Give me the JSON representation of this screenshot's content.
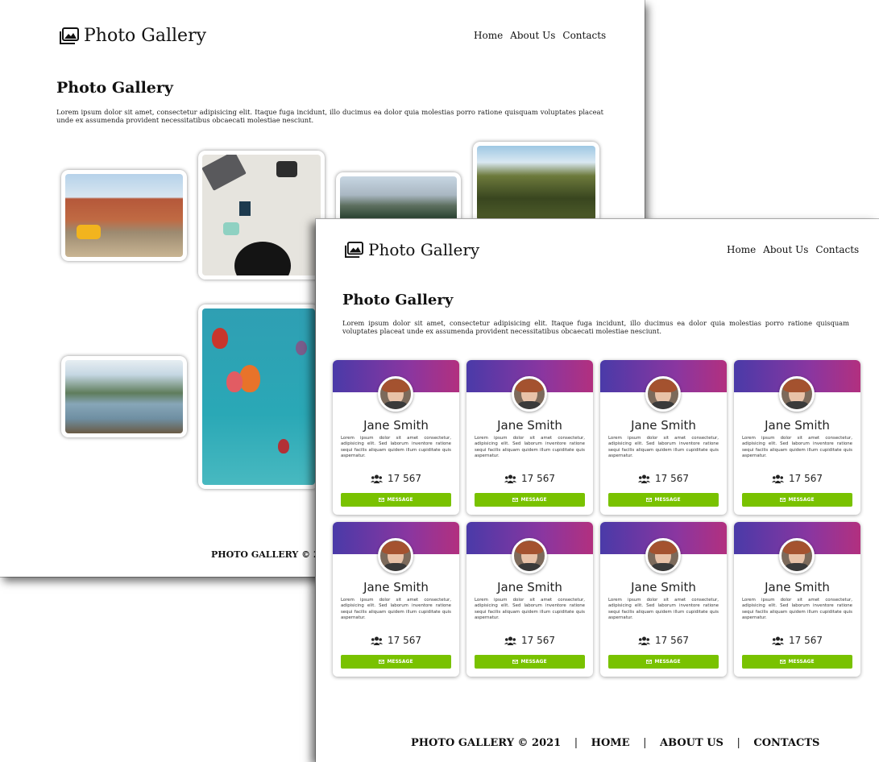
{
  "colors": {
    "card_gradient_start": "#4a3aa8",
    "card_gradient_end": "#b2307f",
    "message_button": "#79c200",
    "text": "#111111"
  },
  "back_page": {
    "logo_text": "Photo Gallery",
    "logo_icon": "image-gallery-icon",
    "nav": [
      "Home",
      "About Us",
      "Contacts"
    ],
    "heading": "Photo Gallery",
    "paragraph": "Lorem ipsum dolor sit amet, consectetur adipisicing elit. Itaque fuga incidunt, illo ducimus ea dolor quia molestias porro ratione quisquam voluptates placeat unde ex assumenda provident necessitatibus obcaecati molestiae nesciunt.",
    "footer_text": "PHOTO GALLERY © 2021",
    "footer_sep": "|"
  },
  "front_page": {
    "logo_text": "Photo Gallery",
    "logo_icon": "image-gallery-icon",
    "nav": [
      "Home",
      "About Us",
      "Contacts"
    ],
    "heading": "Photo Gallery",
    "paragraph": "Lorem ipsum dolor sit amet, consectetur adipisicing elit. Itaque fuga incidunt, illo ducimus ea dolor quia molestias porro ratione quisquam voluptates placeat unde ex assumenda provident necessitatibus obcaecati molestiae nesciunt.",
    "footer": {
      "copyright": "PHOTO GALLERY © 2021",
      "sep": "|",
      "links": [
        "HOME",
        "ABOUT US",
        "CONTACTS"
      ]
    },
    "cards": [
      {
        "name": "Jane Smith",
        "bio": "Lorem ipsum dolor sit amet consectetur, adipisicing elit. Sed laborum inventore ratione sequi facilis aliquam quidem illum cupiditate quis aspernatur.",
        "followers": "17 567",
        "button": "MESSAGE"
      },
      {
        "name": "Jane Smith",
        "bio": "Lorem ipsum dolor sit amet consectetur, adipisicing elit. Sed laborum inventore ratione sequi facilis aliquam quidem illum cupiditate quis aspernatur.",
        "followers": "17 567",
        "button": "MESSAGE"
      },
      {
        "name": "Jane Smith",
        "bio": "Lorem ipsum dolor sit amet consectetur, adipisicing elit. Sed laborum inventore ratione sequi facilis aliquam quidem illum cupiditate quis aspernatur.",
        "followers": "17 567",
        "button": "MESSAGE"
      },
      {
        "name": "Jane Smith",
        "bio": "Lorem ipsum dolor sit amet consectetur, adipisicing elit. Sed laborum inventore ratione sequi facilis aliquam quidem illum cupiditate quis aspernatur.",
        "followers": "17 567",
        "button": "MESSAGE"
      },
      {
        "name": "Jane Smith",
        "bio": "Lorem ipsum dolor sit amet consectetur, adipisicing elit. Sed laborum inventore ratione sequi facilis aliquam quidem illum cupiditate quis aspernatur.",
        "followers": "17 567",
        "button": "MESSAGE"
      },
      {
        "name": "Jane Smith",
        "bio": "Lorem ipsum dolor sit amet consectetur, adipisicing elit. Sed laborum inventore ratione sequi facilis aliquam quidem illum cupiditate quis aspernatur.",
        "followers": "17 567",
        "button": "MESSAGE"
      },
      {
        "name": "Jane Smith",
        "bio": "Lorem ipsum dolor sit amet consectetur, adipisicing elit. Sed laborum inventore ratione sequi facilis aliquam quidem illum cupiditate quis aspernatur.",
        "followers": "17 567",
        "button": "MESSAGE"
      },
      {
        "name": "Jane Smith",
        "bio": "Lorem ipsum dolor sit amet consectetur, adipisicing elit. Sed laborum inventore ratione sequi facilis aliquam quidem illum cupiditate quis aspernatur.",
        "followers": "17 567",
        "button": "MESSAGE"
      }
    ]
  }
}
